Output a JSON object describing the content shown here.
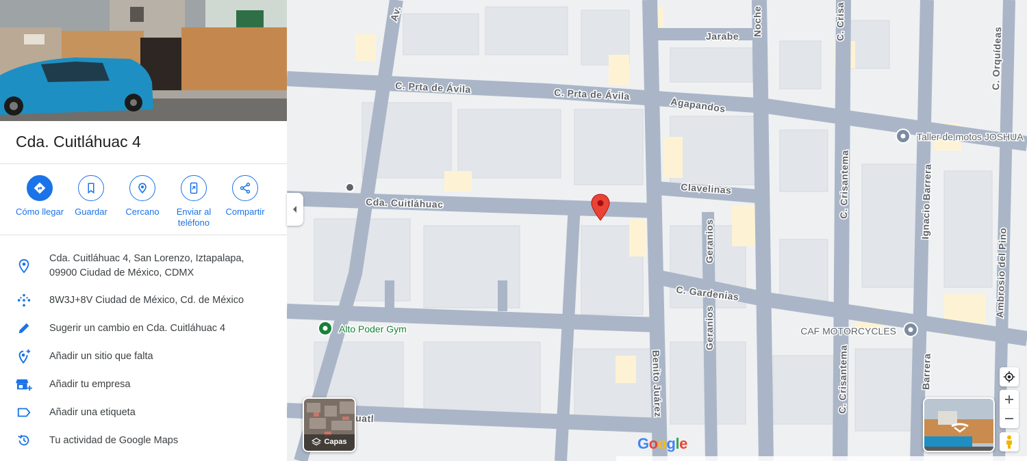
{
  "place": {
    "title": "Cda. Cuitláhuac 4"
  },
  "actions": [
    {
      "label": "Cómo llegar",
      "icon": "directions-icon"
    },
    {
      "label": "Guardar",
      "icon": "bookmark-icon"
    },
    {
      "label": "Cercano",
      "icon": "nearby-icon"
    },
    {
      "label": "Enviar al teléfono",
      "icon": "send-to-phone-icon"
    },
    {
      "label": "Compartir",
      "icon": "share-icon"
    }
  ],
  "info": {
    "address": "Cda. Cuitláhuac 4, San Lorenzo, Iztapalapa, 09900 Ciudad de México, CDMX",
    "plus_code": "8W3J+8V Ciudad de México, Cd. de México",
    "suggest_edit": "Sugerir un cambio en Cda. Cuitláhuac 4",
    "add_missing": "Añadir un sitio que falta",
    "add_business": "Añadir tu empresa",
    "add_label": "Añadir una etiqueta",
    "activity": "Tu actividad de Google Maps"
  },
  "map": {
    "streets": {
      "av": "Av.",
      "jarabe": "Jarabe",
      "noche": "Noche",
      "crisa_top": "C. Crisa",
      "orquideas": "C. Orquídeas",
      "prta_avila_1": "C. Prta de Ávila",
      "prta_avila_2": "C. Prta de Ávila",
      "agapandos": "Agapandos",
      "crisantema_1": "C. Crisantema",
      "ignacio_barrera": "Ignacio Barrera",
      "clavelinas": "Clavelinas",
      "cuitlahuac": "Cda. Cuitláhuac",
      "geranios_1": "Geranios",
      "geranios_2": "Geranios",
      "gardenias": "C. Gardenias",
      "ambrosio": "Ambrosio del Pino",
      "benito_juarez": "Benito Juárez",
      "crisantema_2": "C. Crisantema",
      "barrera_2": "Barrera",
      "uatl": "uatl"
    },
    "pois": {
      "taller": "Taller de motos JOSHUA",
      "gym": "Alto Poder Gym",
      "caf": "CAF MOTORCYCLES"
    },
    "layers_label": "Capas",
    "google_logo": "Google",
    "colors": {
      "accent": "#1a73e8",
      "pin": "#ea4335",
      "road": "#aab6c7",
      "block": "#f1f3f4",
      "poi_green": "#188038"
    }
  }
}
